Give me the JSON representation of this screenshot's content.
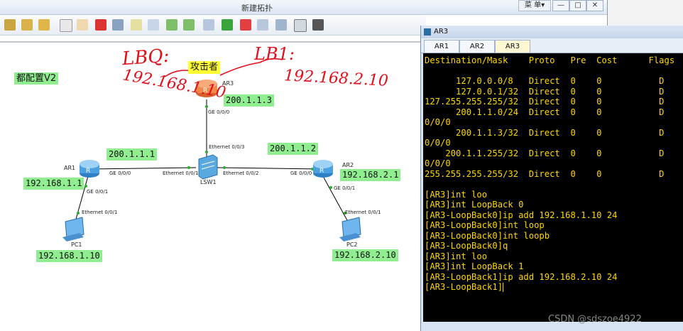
{
  "window": {
    "title": "新建拓扑",
    "menu_label": "菜 单▾",
    "minimize": "—",
    "restore": "□",
    "close": "✕"
  },
  "toolbar": {
    "icons": [
      "new-topology-icon",
      "open-icon",
      "undo-icon",
      "redo-icon",
      "select-icon",
      "pan-hand-icon",
      "delete-icon",
      "clear-icon",
      "text-icon",
      "rectangle-icon",
      "ellipse-icon",
      "zoom-in-icon",
      "zoom-out-icon",
      "fit-icon",
      "start-device-icon",
      "stop-device-icon",
      "capture-icon",
      "grid-icon",
      "console-icon",
      "screenshot-icon"
    ]
  },
  "canvas": {
    "title_label": "都配置V2",
    "attacker_label": "攻击者",
    "handwriting": {
      "lbq": "LBQ:",
      "lbq_ip": "192.168.1.10",
      "lb1": "LB1:",
      "lb1_ip": "192.168.2.10"
    },
    "devices": {
      "ar1": "AR1",
      "ar2": "AR2",
      "ar3": "AR3",
      "lsw1": "LSW1",
      "pc1": "PC1",
      "pc2": "PC2"
    },
    "ips": {
      "ar3_ip": "200.1.1.3",
      "ar1_wan": "200.1.1.1",
      "ar2_wan": "200.1.1.2",
      "ar1_lan": "192.168.1.1",
      "ar2_lan": "192.168.2.1",
      "pc1_ip": "192.168.1.10",
      "pc2_ip": "192.168.2.10"
    },
    "ports": {
      "ar3_ge000": "GE 0/0/0",
      "lsw_eth003": "Ethernet 0/0/3",
      "ar1_ge000": "GE 0/0/0",
      "lsw_eth001": "Ethernet 0/0/1",
      "lsw_eth002": "Ethernet 0/0/2",
      "ar2_ge000": "GE 0/0/0",
      "ar1_ge001": "GE 0/0/1",
      "pc1_eth001": "Ethernet 0/0/1",
      "ar2_ge001": "GE 0/0/1",
      "pc2_eth001": "Ethernet 0/0/1"
    }
  },
  "terminal_window": {
    "title": "AR3",
    "tabs": [
      "AR1",
      "AR2",
      "AR3"
    ],
    "active_tab": "AR3",
    "lines": [
      "Destination/Mask    Proto   Pre  Cost      Flags",
      "",
      "      127.0.0.0/8   Direct  0    0           D",
      "      127.0.0.1/32  Direct  0    0           D",
      "127.255.255.255/32  Direct  0    0           D",
      "      200.1.1.0/24  Direct  0    0           D",
      "0/0/0",
      "      200.1.1.3/32  Direct  0    0           D",
      "0/0/0",
      "    200.1.1.255/32  Direct  0    0           D",
      "0/0/0",
      "255.255.255.255/32  Direct  0    0           D",
      "",
      "[AR3]int loo",
      "[AR3]int LoopBack 0",
      "[AR3-LoopBack0]ip add 192.168.1.10 24",
      "[AR3-LoopBack0]int loop",
      "[AR3-LoopBack0]int loopb",
      "[AR3-LoopBack0]q",
      "[AR3]int loo",
      "[AR3]int LoopBack 1",
      "[AR3-LoopBack1]ip add 192.168.2.10 24",
      "[AR3-LoopBack1]"
    ]
  },
  "watermark": "CSDN @sdszoe4922",
  "colors": {
    "terminal_text": "#ffd700",
    "ip_label_bg": "#90ee90",
    "attacker_label_bg": "#ffff33",
    "handwriting": "#e0101a"
  }
}
